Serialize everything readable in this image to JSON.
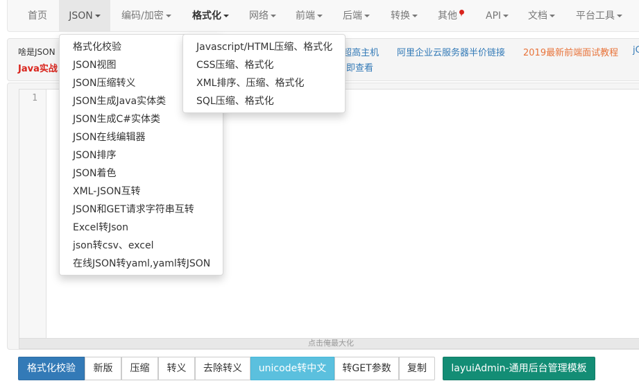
{
  "navbar": {
    "items": [
      {
        "label": "首页"
      },
      {
        "label": "JSON"
      },
      {
        "label": "编码/加密"
      },
      {
        "label": "格式化"
      },
      {
        "label": "网络"
      },
      {
        "label": "前端"
      },
      {
        "label": "后端"
      },
      {
        "label": "转换"
      },
      {
        "label": "其他"
      },
      {
        "label": "API"
      },
      {
        "label": "文档"
      },
      {
        "label": "平台工具"
      }
    ],
    "active_item": "JSON",
    "highlight_item": "格式化",
    "badge_color": "#d9241c"
  },
  "notice": {
    "prefix": "啥是JSON",
    "red_text": "Java实战",
    "links": [
      {
        "text": "t超高主机",
        "color": "#337ab7"
      },
      {
        "text": "阿里企业云服务器半价链接",
        "color": "#337ab7"
      },
      {
        "text": "2019最新前端面试教程",
        "color": "#e8743b"
      },
      {
        "text": "jC",
        "color": "#337ab7"
      }
    ],
    "second_line_link": "即查看"
  },
  "editor": {
    "line_numbers": [
      "1"
    ],
    "maximize_hint": "点击俺最大化"
  },
  "buttons": [
    {
      "label": "格式化校验",
      "style": "primary"
    },
    {
      "label": "新版",
      "style": "default"
    },
    {
      "label": "压缩",
      "style": "default"
    },
    {
      "label": "转义",
      "style": "default"
    },
    {
      "label": "去除转义",
      "style": "default"
    },
    {
      "label": "unicode转中文",
      "style": "info"
    },
    {
      "label": "转GET参数",
      "style": "default"
    },
    {
      "label": "复制",
      "style": "default"
    },
    {
      "label": "layuiAdmin-通用后台管理模板",
      "style": "success"
    }
  ],
  "json_menu": {
    "items": [
      "格式化校验",
      "JSON视图",
      "JSON压缩转义",
      "JSON生成Java实体类",
      "JSON生成C#实体类",
      "JSON在线编辑器",
      "JSON排序",
      "JSON着色",
      "XML-JSON互转",
      "JSON和GET请求字符串互转",
      "Excel转Json",
      "json转csv、excel",
      "在线JSON转yaml,yaml转JSON"
    ]
  },
  "format_menu": {
    "items": [
      "Javascript/HTML压缩、格式化",
      "CSS压缩、格式化",
      "XML排序、压缩、格式化",
      "SQL压缩、格式化"
    ]
  },
  "colors": {
    "primary": "#337ab7",
    "info": "#5bc0de",
    "success": "#138d75",
    "danger": "#d9241c",
    "orange_link": "#e8743b"
  }
}
